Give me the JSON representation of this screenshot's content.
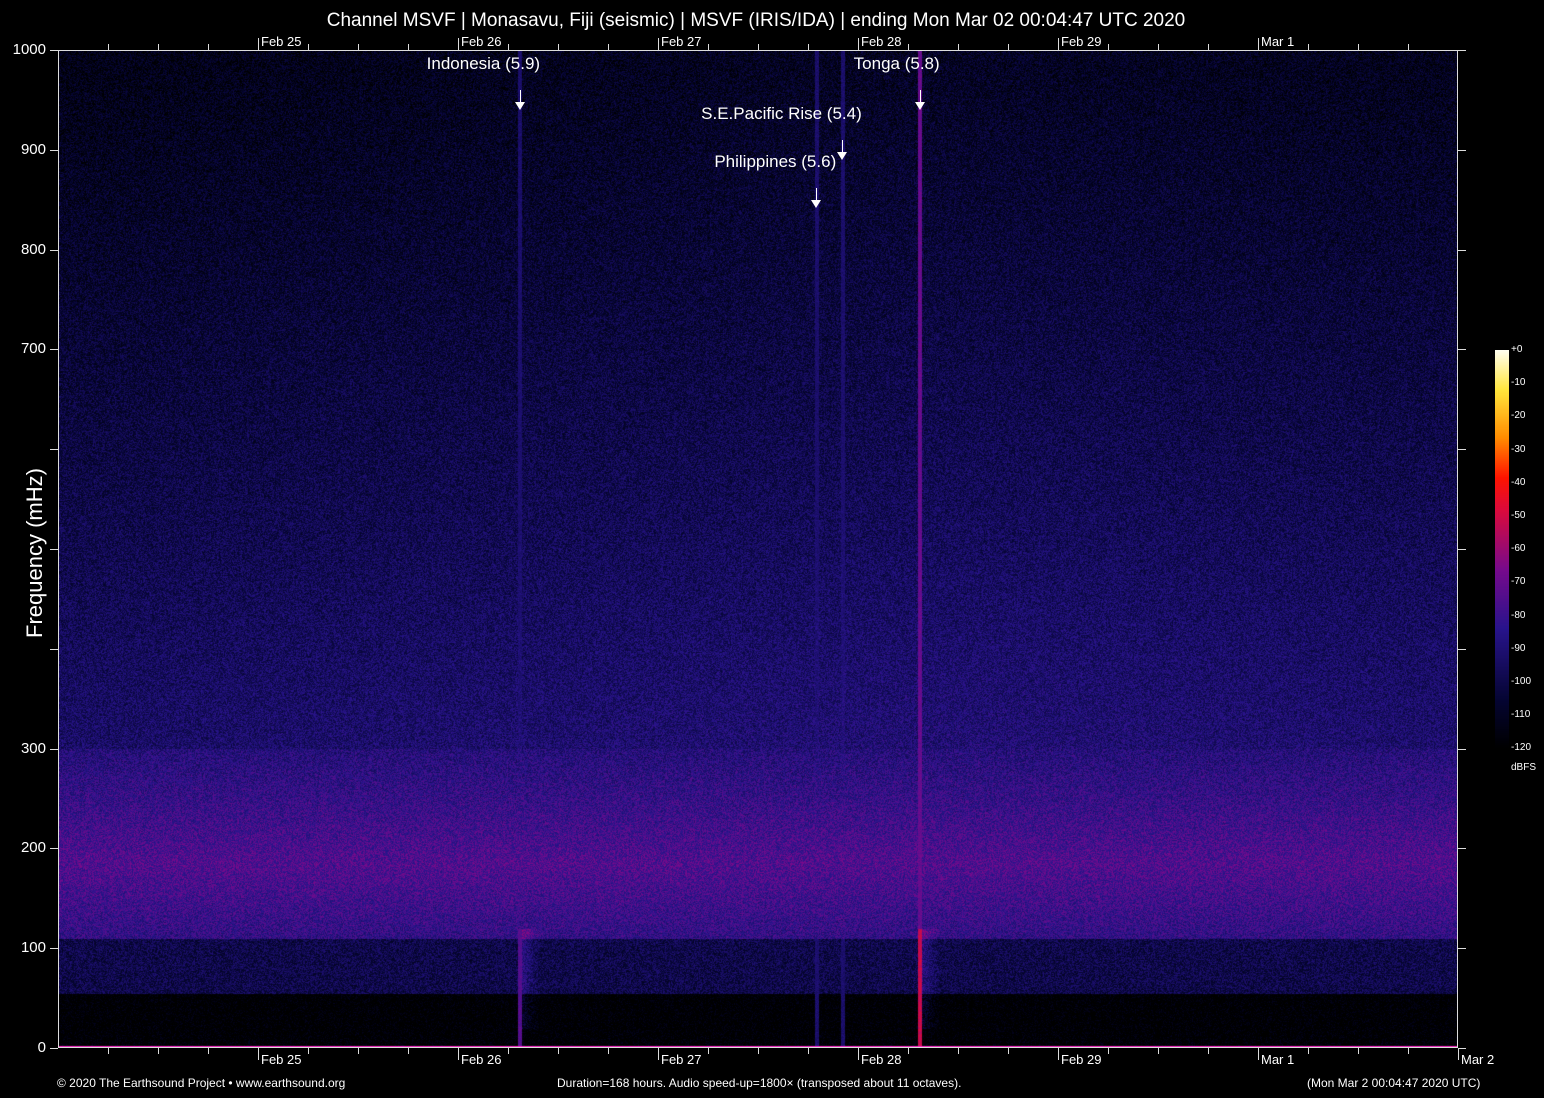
{
  "chart_data": {
    "type": "heatmap",
    "title": "Channel MSVF | Monasavu, Fiji (seismic) | MSVF (IRIS/IDA) | ending Mon Mar 02 00:04:47 UTC 2020",
    "ylabel": "Frequency (mHz)",
    "ylim": [
      0,
      1000
    ],
    "yticks": [
      0,
      100,
      200,
      300,
      400,
      500,
      600,
      700,
      800,
      900,
      1000
    ],
    "ytick_labels": [
      "0",
      "100",
      "200",
      "300",
      "",
      "",
      "",
      "700",
      "800",
      "900",
      "1000"
    ],
    "xlim_hours": [
      0,
      168
    ],
    "xticks_hours": [
      24,
      48,
      72,
      96,
      120,
      144,
      168
    ],
    "xtick_labels": [
      "Feb 25",
      "Feb 26",
      "Feb 27",
      "Feb 28",
      "Feb 29",
      "Mar  1",
      "Mar  2"
    ],
    "annotations": [
      {
        "label": "Indonesia (5.9)",
        "time_hours": 55.4,
        "freq_mHz": 940
      },
      {
        "label": "Tonga (5.8)",
        "time_hours": 103.4,
        "freq_mHz": 940
      },
      {
        "label": "S.E.Pacific Rise (5.4)",
        "time_hours": 94.1,
        "freq_mHz": 890
      },
      {
        "label": "Philippines (5.6)",
        "time_hours": 91.0,
        "freq_mHz": 842
      }
    ],
    "colorbar": {
      "label": "dBFS",
      "range": [
        -120,
        0
      ],
      "ticks": [
        "+0",
        "-10",
        "-20",
        "-30",
        "-40",
        "-50",
        "-60",
        "-70",
        "-80",
        "-90",
        "-100",
        "-110",
        "-120"
      ]
    },
    "grid": false
  },
  "footer": {
    "left": "© 2020 The Earthsound Project • www.earthsound.org",
    "center": "Duration=168 hours. Audio speed-up=1800× (transposed about 11 octaves).",
    "right": "(Mon Mar  2 00:04:47 2020 UTC)"
  }
}
